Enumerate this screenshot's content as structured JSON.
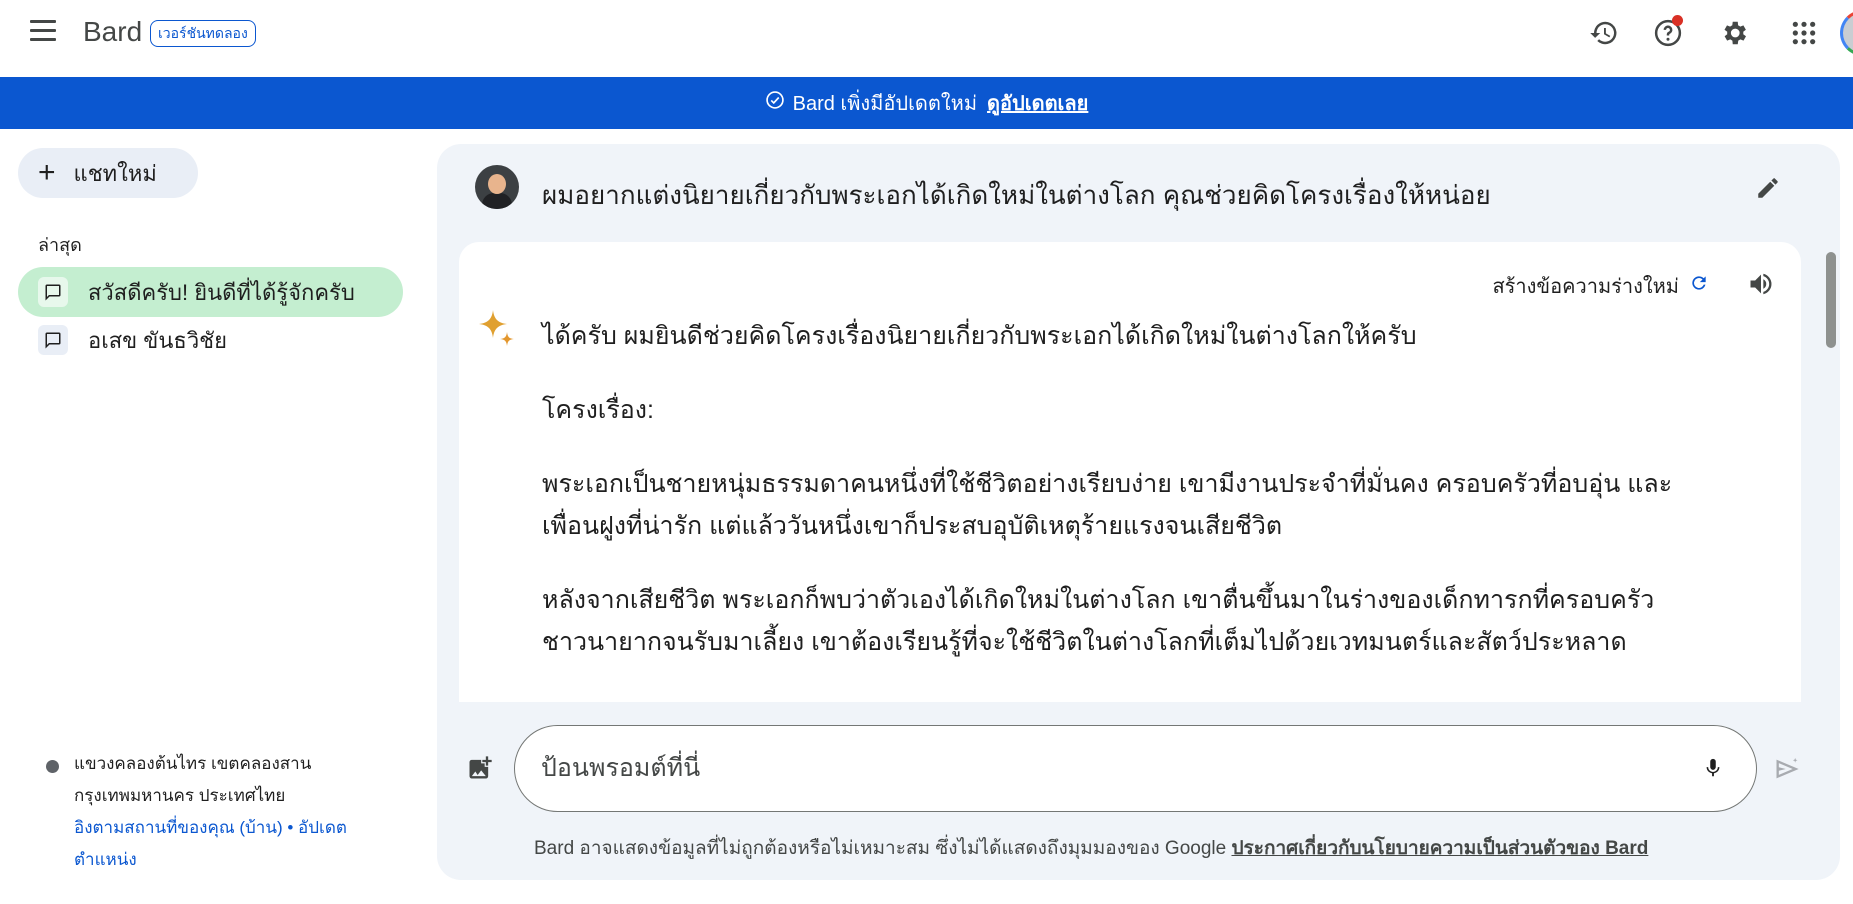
{
  "header": {
    "brand": "Bard",
    "badge": "เวอร์ชันทดลอง",
    "icons": [
      "hamburger-menu-icon",
      "history-icon",
      "help-icon",
      "settings-gear-icon",
      "apps-grid-icon",
      "account-avatar"
    ],
    "colors": {
      "accent": "#0b57d0",
      "notification": "#d93025"
    }
  },
  "banner": {
    "text": "Bard เพิ่งมีอัปเดตใหม่",
    "link": "ดูอัปเดตเลย"
  },
  "sidebar": {
    "new_chat": "แชทใหม่",
    "recent_label": "ล่าสุด",
    "items": [
      {
        "label": "สวัสดีครับ! ยินดีที่ได้รู้จักครับ",
        "active": true
      },
      {
        "label": "อเสข ขันธวิชัย",
        "active": false
      }
    ],
    "location": {
      "line1": "แขวงคลองต้นไทร เขตคลองสาน",
      "line2": "กรุงเทพมหานคร ประเทศไทย",
      "link1": "อิงตามสถานที่ของคุณ (บ้าน)",
      "separator": "•",
      "link2": "อัปเดต",
      "link2_cont": "ตำแหน่ง"
    }
  },
  "conversation": {
    "user_prompt": "ผมอยากแต่งนิยายเกี่ยวกับพระเอกได้เกิดใหม่ในต่างโลก คุณช่วยคิดโครงเรื่องให้หน่อย",
    "regenerate_label": "สร้างข้อความร่างใหม่",
    "response": {
      "p1": "ได้ครับ ผมยินดีช่วยคิดโครงเรื่องนิยายเกี่ยวกับพระเอกได้เกิดใหม่ในต่างโลกให้ครับ",
      "p2": "โครงเรื่อง:",
      "p3a": "พระเอกเป็นชายหนุ่มธรรมดาคนหนึ่งที่ใช้ชีวิตอย่างเรียบง่าย เขามีงานประจำที่มั่นคง ครอบครัวที่อบอุ่น และ",
      "p3b": "เพื่อนฝูงที่น่ารัก แต่แล้ววันหนึ่งเขาก็ประสบอุบัติเหตุร้ายแรงจนเสียชีวิต",
      "p4a": "หลังจากเสียชีวิต พระเอกก็พบว่าตัวเองได้เกิดใหม่ในต่างโลก เขาตื่นขึ้นมาในร่างของเด็กทารกที่ครอบครัว",
      "p4b": "ชาวนายากจนรับมาเลี้ยง เขาต้องเรียนรู้ที่จะใช้ชีวิตในต่างโลกที่เต็มไปด้วยเวทมนตร์และสัตว์ประหลาด"
    }
  },
  "composer": {
    "placeholder": "ป้อนพรอมต์ที่นี่",
    "disclaimer": "Bard อาจแสดงข้อมูลที่ไม่ถูกต้องหรือไม่เหมาะสม ซึ่งไม่ได้แสดงถึงมุมมองของ Google",
    "disclaimer_link": "ประกาศเกี่ยวกับนโยบายความเป็นส่วนตัวของ Bard"
  }
}
